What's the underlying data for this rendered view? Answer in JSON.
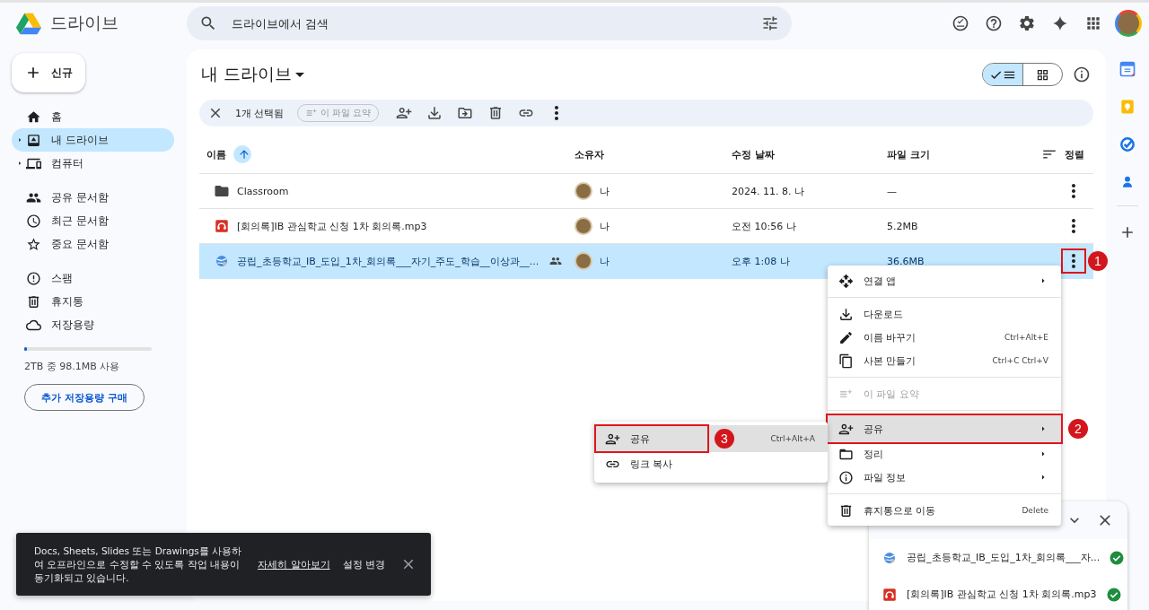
{
  "app": {
    "name": "드라이브"
  },
  "search": {
    "placeholder": "드라이브에서 검색"
  },
  "new_button": "신규",
  "sidebar": {
    "groups": [
      [
        {
          "label": "홈",
          "selected": false,
          "has_children": false
        },
        {
          "label": "내 드라이브",
          "selected": true,
          "has_children": true
        },
        {
          "label": "컴퓨터",
          "selected": false,
          "has_children": true
        }
      ],
      [
        {
          "label": "공유 문서함",
          "selected": false,
          "has_children": false
        },
        {
          "label": "최근 문서함",
          "selected": false,
          "has_children": false
        },
        {
          "label": "중요 문서함",
          "selected": false,
          "has_children": false
        }
      ],
      [
        {
          "label": "스팸",
          "selected": false,
          "has_children": false
        },
        {
          "label": "휴지통",
          "selected": false,
          "has_children": false
        },
        {
          "label": "저장용량",
          "selected": false,
          "has_children": false
        }
      ]
    ]
  },
  "storage": {
    "level": 0.02,
    "text": "2TB 중 98.1MB 사용",
    "button": "추가 저장용량 구매"
  },
  "page_title": "내 드라이브",
  "view_toggle": [
    {
      "kind": "list",
      "selected": true
    },
    {
      "kind": "grid",
      "selected": false
    }
  ],
  "selection_bar": {
    "count": "1개 선택됨",
    "summarize": "이 파일 요약"
  },
  "table": {
    "columns": [
      "이름",
      "소유자",
      "수정 날짜",
      "파일 크기"
    ],
    "sort": "정렬",
    "rows": [
      {
        "name": "Classroom",
        "kind": "folder",
        "shared": false,
        "owner": "나",
        "modified": "2024. 11. 8. 나",
        "size": "—",
        "selected": false
      },
      {
        "name": "[회의록]IB 관심학교 신청 1차 회의록.mp3",
        "kind": "audio",
        "shared": false,
        "owner": "나",
        "modified": "오전 10:56 나",
        "size": "5.2MB",
        "selected": false
      },
      {
        "name": "공립_초등학교_IB_도입_1차_회의록___자기_주도_학습__이상과__...",
        "kind": "link",
        "shared": true,
        "owner": "나",
        "modified": "오후 1:08 나",
        "size": "36.6MB",
        "selected": true,
        "annotation": "1"
      }
    ]
  },
  "context_menu": {
    "groups": [
      [
        {
          "label": "연결 앱",
          "submenu": true,
          "disabled": false,
          "highlighted": false
        }
      ],
      [
        {
          "label": "다운로드",
          "submenu": false,
          "disabled": false,
          "highlighted": false
        },
        {
          "label": "이름 바꾸기",
          "shortcut": "Ctrl+Alt+E",
          "submenu": false,
          "disabled": false,
          "highlighted": false
        },
        {
          "label": "사본 만들기",
          "shortcut": "Ctrl+C Ctrl+V",
          "submenu": false,
          "disabled": false,
          "highlighted": false
        }
      ],
      [
        {
          "label": "이 파일 요약",
          "submenu": false,
          "disabled": true,
          "highlighted": false
        }
      ],
      [
        {
          "label": "공유",
          "submenu": true,
          "disabled": false,
          "highlighted": true,
          "annotation": "2"
        },
        {
          "label": "정리",
          "submenu": true,
          "disabled": false,
          "highlighted": false
        },
        {
          "label": "파일 정보",
          "submenu": true,
          "disabled": false,
          "highlighted": false
        }
      ],
      [
        {
          "label": "휴지통으로 이동",
          "shortcut": "Delete",
          "submenu": false,
          "disabled": false,
          "highlighted": false
        }
      ]
    ]
  },
  "submenu": [
    {
      "label": "공유",
      "shortcut": "Ctrl+Alt+A",
      "highlighted": true,
      "annotation": "3"
    },
    {
      "label": "링크 복사",
      "highlighted": false
    }
  ],
  "toast": {
    "message": "Docs, Sheets, Slides 또는 Drawings를 사용하여 오프라인으로 수정할 수 있도록 작업 내용이 동기화되고 있습니다.",
    "link": "자세히 알아보기",
    "action": "설정 변경"
  },
  "upload_panel": {
    "items": [
      {
        "name": "공립_초등학교_IB_도입_1차_회의록___자...",
        "kind": "link",
        "done": true
      },
      {
        "name": "[회의록]IB 관심학교 신청 1차 회의록.mp3",
        "kind": "audio",
        "done": true
      }
    ]
  }
}
